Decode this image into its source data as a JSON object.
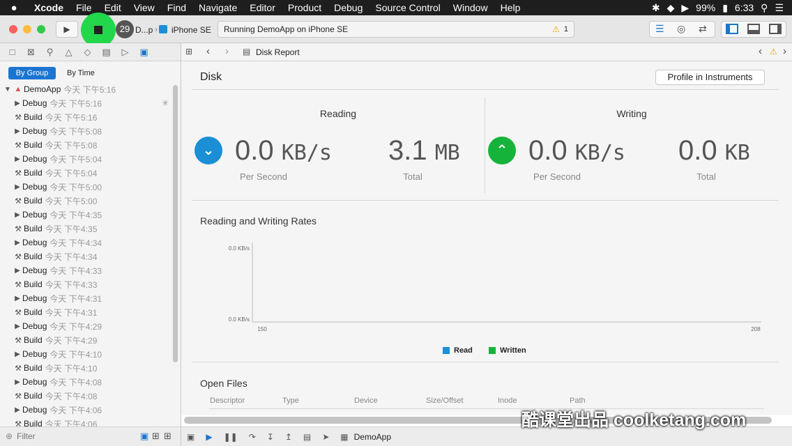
{
  "menubar": {
    "apple": "",
    "items": [
      "Xcode",
      "File",
      "Edit",
      "View",
      "Find",
      "Navigate",
      "Editor",
      "Product",
      "Debug",
      "Source Control",
      "Window",
      "Help"
    ],
    "battery": "99%",
    "time": "6:33"
  },
  "toolbar": {
    "badge_count": "29",
    "scheme": "D...p",
    "device": "iPhone SE",
    "status": "Running DemoApp on iPhone SE",
    "warnings": "1"
  },
  "navigator": {
    "tab_by_group": "By Group",
    "tab_by_time": "By Time",
    "project": {
      "name": "DemoApp",
      "time": "今天 下午5:16"
    },
    "rows": [
      {
        "type": "Debug",
        "time": "今天 下午5:16"
      },
      {
        "type": "Build",
        "time": "今天 下午5:16"
      },
      {
        "type": "Debug",
        "time": "今天 下午5:08"
      },
      {
        "type": "Build",
        "time": "今天 下午5:08"
      },
      {
        "type": "Debug",
        "time": "今天 下午5:04"
      },
      {
        "type": "Build",
        "time": "今天 下午5:04"
      },
      {
        "type": "Debug",
        "time": "今天 下午5:00"
      },
      {
        "type": "Build",
        "time": "今天 下午5:00"
      },
      {
        "type": "Debug",
        "time": "今天 下午4:35"
      },
      {
        "type": "Build",
        "time": "今天 下午4:35"
      },
      {
        "type": "Debug",
        "time": "今天 下午4:34"
      },
      {
        "type": "Build",
        "time": "今天 下午4:34"
      },
      {
        "type": "Debug",
        "time": "今天 下午4:33"
      },
      {
        "type": "Build",
        "time": "今天 下午4:33"
      },
      {
        "type": "Debug",
        "time": "今天 下午4:31"
      },
      {
        "type": "Build",
        "time": "今天 下午4:31"
      },
      {
        "type": "Debug",
        "time": "今天 下午4:29"
      },
      {
        "type": "Build",
        "time": "今天 下午4:29"
      },
      {
        "type": "Debug",
        "time": "今天 下午4:10"
      },
      {
        "type": "Build",
        "time": "今天 下午4:10"
      },
      {
        "type": "Debug",
        "time": "今天 下午4:08"
      },
      {
        "type": "Build",
        "time": "今天 下午4:08"
      },
      {
        "type": "Debug",
        "time": "今天 下午4:06"
      },
      {
        "type": "Build",
        "time": "今天 下午4:06"
      }
    ],
    "filter_placeholder": "Filter"
  },
  "jumpbar": {
    "title": "Disk Report"
  },
  "report": {
    "title": "Disk",
    "profile_button": "Profile in Instruments",
    "reading": {
      "title": "Reading",
      "rate": "0.0",
      "rate_unit": "KB/s",
      "rate_label": "Per Second",
      "total": "3.1",
      "total_unit": "MB",
      "total_label": "Total"
    },
    "writing": {
      "title": "Writing",
      "rate": "0.0",
      "rate_unit": "KB/s",
      "rate_label": "Per Second",
      "total": "0.0",
      "total_unit": "KB",
      "total_label": "Total"
    },
    "rates_title": "Reading and Writing Rates",
    "open_files_title": "Open Files",
    "columns": [
      "Descriptor",
      "Type",
      "Device",
      "Size/Offset",
      "Inode",
      "Path"
    ]
  },
  "chart_data": {
    "type": "line",
    "title": "Reading and Writing Rates",
    "x": [
      150,
      208
    ],
    "xlim": [
      150,
      208
    ],
    "y_tick_top": "0.0 KB/s",
    "y_tick_bottom": "0.0 KB/s",
    "x_tick_left": "150",
    "x_tick_right": "208",
    "series": [
      {
        "name": "Read",
        "values": [
          0,
          0
        ],
        "color": "#1b8fd6"
      },
      {
        "name": "Written",
        "values": [
          0,
          0
        ],
        "color": "#16b33a"
      }
    ],
    "legend": "bottom-center"
  },
  "debugbar": {
    "target": "DemoApp"
  },
  "watermark": "酷课堂出品 coolketang.com",
  "colors": {
    "reading": "#1b8fd6",
    "writing": "#16b33a",
    "accent": "#1b75d0"
  }
}
